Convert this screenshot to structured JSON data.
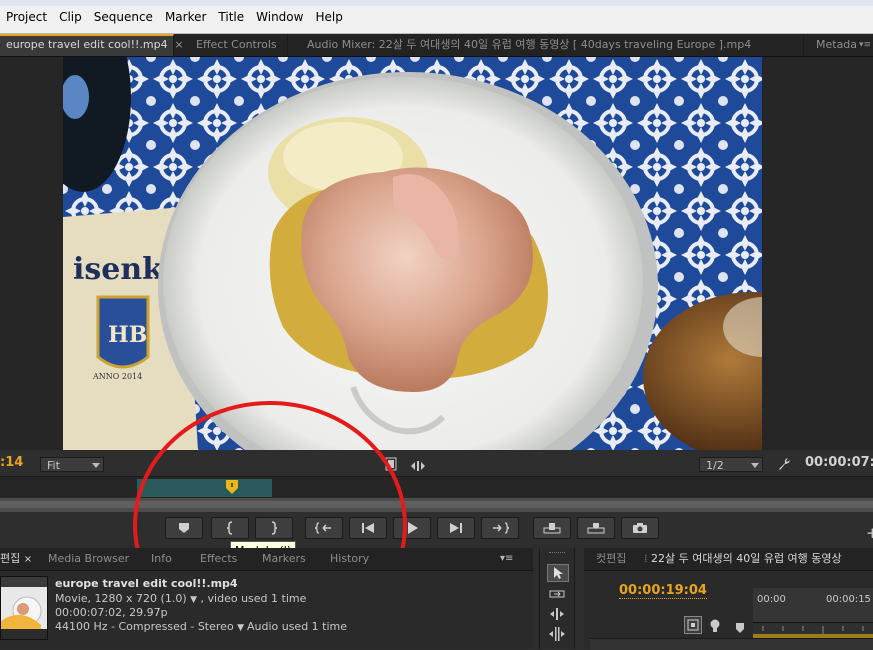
{
  "menu": [
    "Project",
    "Clip",
    "Sequence",
    "Marker",
    "Title",
    "Window",
    "Help"
  ],
  "source_tabs": {
    "active": "europe travel edit cool!!.mp4",
    "close": "×",
    "effect_controls": "Effect Controls",
    "audio_mixer": "Audio Mixer: 22살 두 여대생의 40일 유럽 여행 동영상 [ 40days traveling Europe ].mp4",
    "metadata": "Metada"
  },
  "monitor": {
    "timecode_left": ":14",
    "zoom": "Fit",
    "resolution": "1/2",
    "timecode_right": "00:00:07:0"
  },
  "video_scene": {
    "label_text": "isenk",
    "badge_text": "HB",
    "anno_text": "ANNO 2014"
  },
  "tooltip": "Mark In (I)",
  "project_tabs": [
    "편집",
    "Media Browser",
    "Info",
    "Effects",
    "Markers",
    "History"
  ],
  "project_item": {
    "name": "europe travel edit cool!!.mp4",
    "line1": "Movie, 1280 x 720 (1.0)",
    "line1_suffix": ", video used 1 time",
    "line2": "00:00:07:02, 29.97p",
    "line3": "44100 Hz - Compressed - Stereo",
    "line3_suffix": "Audio used 1 time"
  },
  "sequence": {
    "tab_left": "컷편집",
    "tab_main": "22살 두 여대생의 40일 유럽 여행 동영상",
    "timecode": "00:00:19:04",
    "ruler_start": "00:00",
    "ruler_next": "00:00:15"
  },
  "colors": {
    "accent": "#e8a41c",
    "annotation": "#e51b1b",
    "panel": "#2d2d2d"
  }
}
